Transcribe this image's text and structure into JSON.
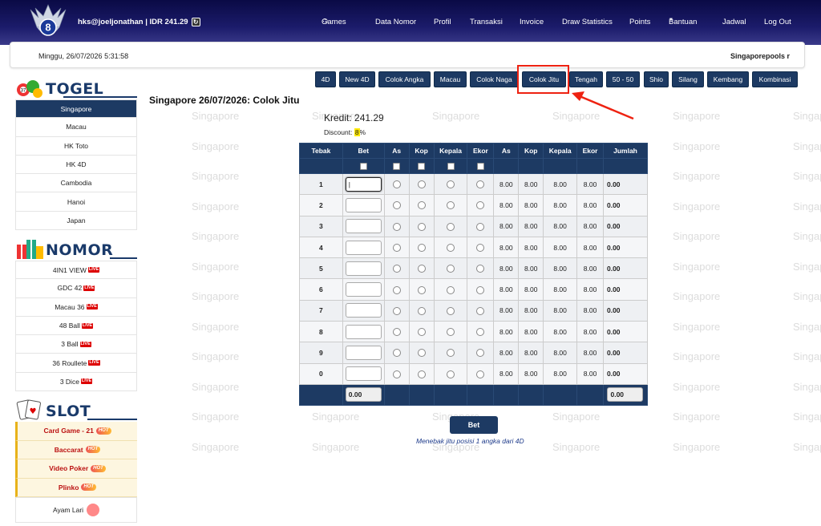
{
  "header": {
    "user_info": "hks@joeljonathan | IDR 241.29",
    "menu": [
      "Games",
      "Data Nomor",
      "Profil",
      "Transaksi",
      "Invoice",
      "Draw Statistics",
      "Points",
      "Bantuan",
      "Jadwal",
      "Log Out"
    ],
    "logo_number": "8"
  },
  "datebar": {
    "date": "Minggu, 26/07/2026 5:31:58",
    "marquee": "Singaporepools r"
  },
  "sidebar": {
    "togel_title": "TOGEL",
    "togel_items": [
      "Singapore",
      "Macau",
      "HK Toto",
      "HK 4D",
      "Cambodia",
      "Hanoi",
      "Japan"
    ],
    "nomor_title": "NOMOR",
    "nomor_items": [
      "4IN1 VIEW",
      "GDC 42",
      "Macau 36",
      "48 Ball",
      "3 Ball",
      "36 Roullete",
      "3 Dice"
    ],
    "live_label": "LIVE",
    "slot_title": "SLOT",
    "slot_items": [
      "Card Game - 21",
      "Baccarat",
      "Video Poker",
      "Plinko"
    ],
    "hot_label": "HOT",
    "extra_item": "Ayam Lari"
  },
  "tabs": [
    "4D",
    "New 4D",
    "Colok Angka",
    "Macau",
    "Colok Naga",
    "Colok Jitu",
    "Tengah",
    "50 - 50",
    "Shio",
    "Silang",
    "Kembang",
    "Kombinasi"
  ],
  "active_tab": "Colok Jitu",
  "watermark": "Singapore",
  "main": {
    "title": "Singapore 26/07/2026: Colok Jitu",
    "kredit_label": "Kredit:",
    "kredit_value": "241.29",
    "discount_label": "Discount:",
    "discount_value": "8",
    "discount_unit": "%"
  },
  "table": {
    "headers": [
      "Tebak",
      "Bet",
      "As",
      "Kop",
      "Kepala",
      "Ekor",
      "As",
      "Kop",
      "Kepala",
      "Ekor",
      "Jumlah"
    ],
    "rows": [
      "1",
      "2",
      "3",
      "4",
      "5",
      "6",
      "7",
      "8",
      "9",
      "0"
    ],
    "odds": [
      "8.00",
      "8.00",
      "8.00",
      "8.00"
    ],
    "row_total": "0.00",
    "bet_total": "0.00",
    "grand_total": "0.00"
  },
  "bet_button": "Bet",
  "hint": "Menebak jitu posisi 1 angka dari 4D",
  "colors": {
    "navy": "#1d3a63",
    "highlight": "#e21",
    "hot": "#fb3"
  }
}
